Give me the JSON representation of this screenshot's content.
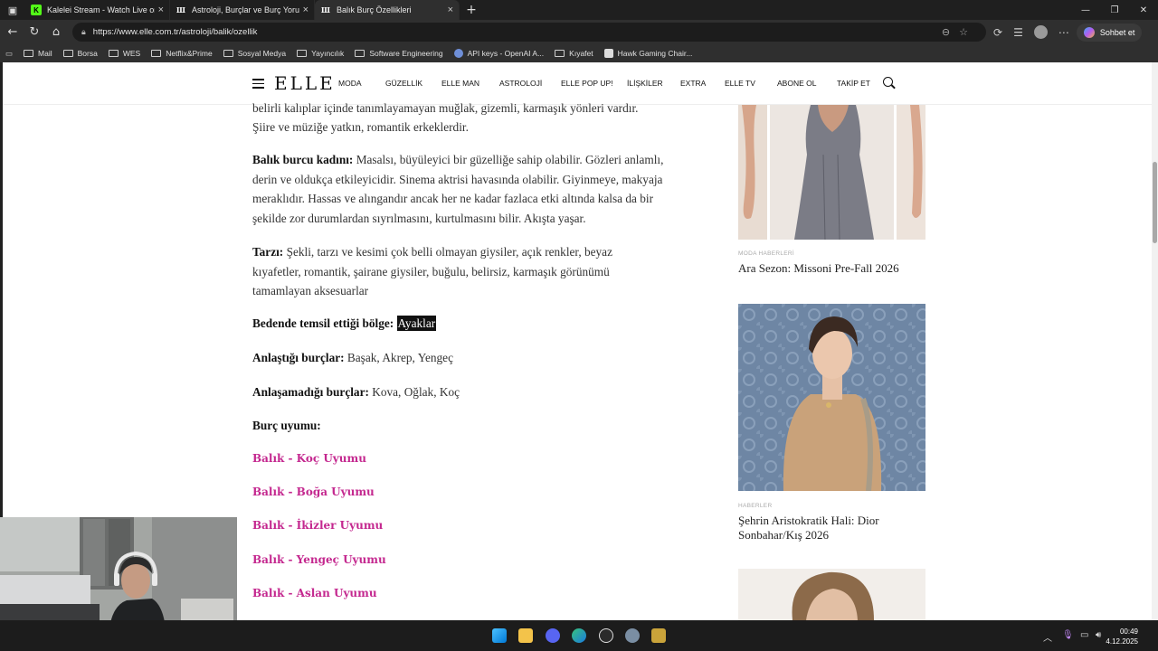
{
  "browser": {
    "tabs": [
      {
        "title": "Kalelei Stream - Watch Live on Kick",
        "favicon": "kick-icon",
        "active": false
      },
      {
        "title": "Astroloji, Burçlar ve Burç Yorumları",
        "favicon": "elle-icon",
        "active": false
      },
      {
        "title": "Balık Burç Özellikleri",
        "favicon": "elle-icon",
        "active": true
      }
    ],
    "url": "https://www.elle.com.tr/astroloji/balik/ozellik",
    "copilot_label": "Sohbet et",
    "bookmarks": [
      "Mail",
      "Borsa",
      "WES",
      "Netflix&Prime",
      "Sosyal Medya",
      "Yayıncılık",
      "Software Engineering",
      "API keys - OpenAI A...",
      "Kıyafet",
      "Hawk Gaming Chair..."
    ]
  },
  "site": {
    "logo": "ELLE",
    "nav": [
      "MODA",
      "GÜZELLİK",
      "ELLE MAN",
      "ASTROLOJİ",
      "ELLE POP UP!",
      "İLİŞKİLER",
      "EXTRA",
      "ELLE TV",
      "ABONE OL",
      "TAKİP ET"
    ]
  },
  "article": {
    "intro_line1": "belirli kalıplar içinde tanımlayamayan muğlak, gizemli, karmaşık yönleri vardır.",
    "intro_line2": "Şiire ve müziğe yatkın, romantik erkeklerdir.",
    "woman_label": "Balık burcu kadını:",
    "woman_text": "Masalsı, büyüleyici bir güzelliğe sahip olabilir. Gözleri anlamlı, derin ve oldukça etkileyicidir. Sinema aktrisi havasında olabilir. Giyinmeye, makyaja meraklıdır. Hassas ve alıngandır ancak her ne kadar fazlaca etki altında kalsa da bir şekilde zor durumlardan sıyrılmasını, kurtulmasını bilir. Akışta yaşar.",
    "style_label": "Tarzı:",
    "style_text": "Şekli, tarzı ve kesimi çok belli olmayan giysiler, açık renkler, beyaz kıyafetler, romantik, şairane giysiler, buğulu, belirsiz, karmaşık görünümü tamamlayan aksesuarlar",
    "body_label": "Bedende temsil ettiği bölge:",
    "body_value": "Ayaklar",
    "compat_label": "Anlaştığı burçlar:",
    "compat_value": "Başak, Akrep, Yengeç",
    "incompat_label": "Anlaşamadığı burçlar:",
    "incompat_value": "Kova, Oğlak, Koç",
    "harmony_label": "Burç uyumu:",
    "links": [
      "Balık - Koç Uyumu",
      "Balık - Boğa Uyumu",
      "Balık - İkizler Uyumu",
      "Balık - Yengeç Uyumu",
      "Balık - Aslan Uyumu"
    ]
  },
  "sidebar": {
    "cards": [
      {
        "category": "MODA HABERLERİ",
        "title": "Ara Sezon: Missoni Pre-Fall 2026"
      },
      {
        "category": "HABERLER",
        "title": "Şehrin Aristokratik Hali: Dior Sonbahar/Kış 2026"
      }
    ]
  },
  "taskbar": {
    "time": "00:49",
    "date": "4.12.2025"
  },
  "colors": {
    "link": "#c4288f",
    "highlight_bg": "#111111"
  }
}
